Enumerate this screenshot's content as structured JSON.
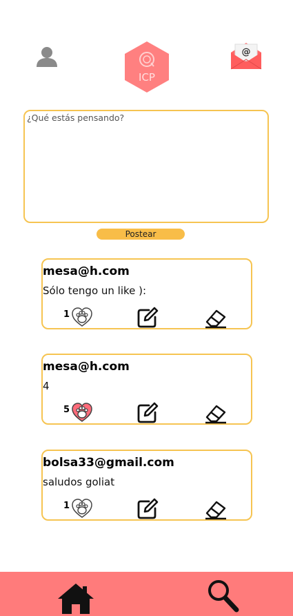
{
  "header": {
    "profile_icon": "user-icon",
    "logo_text": "ICP",
    "mail_icon": "mail-icon",
    "colors": {
      "logo": "#ff7f7f",
      "mail": "#ff6b6b",
      "profile": "#8a8a8a"
    }
  },
  "composer": {
    "placeholder": "¿Qué estás pensando?",
    "value": "",
    "post_label": "Postear"
  },
  "posts": [
    {
      "author": "mesa@h.com",
      "text": "Sólo tengo un like ):",
      "likes": "1",
      "liked": false
    },
    {
      "author": "mesa@h.com",
      "text": "4",
      "likes": "5",
      "liked": true
    },
    {
      "author": "bolsa33@gmail.com",
      "text": "saludos goliat",
      "likes": "1",
      "liked": false
    }
  ],
  "actions": {
    "edit_icon": "edit-icon",
    "delete_icon": "eraser-icon",
    "like_icon": "paw-heart-icon"
  },
  "bottom_nav": {
    "home_icon": "home-icon",
    "search_icon": "search-icon",
    "background": "#ff7b7b"
  },
  "theme": {
    "accent": "#f6c451",
    "button": "#f8bd48"
  }
}
